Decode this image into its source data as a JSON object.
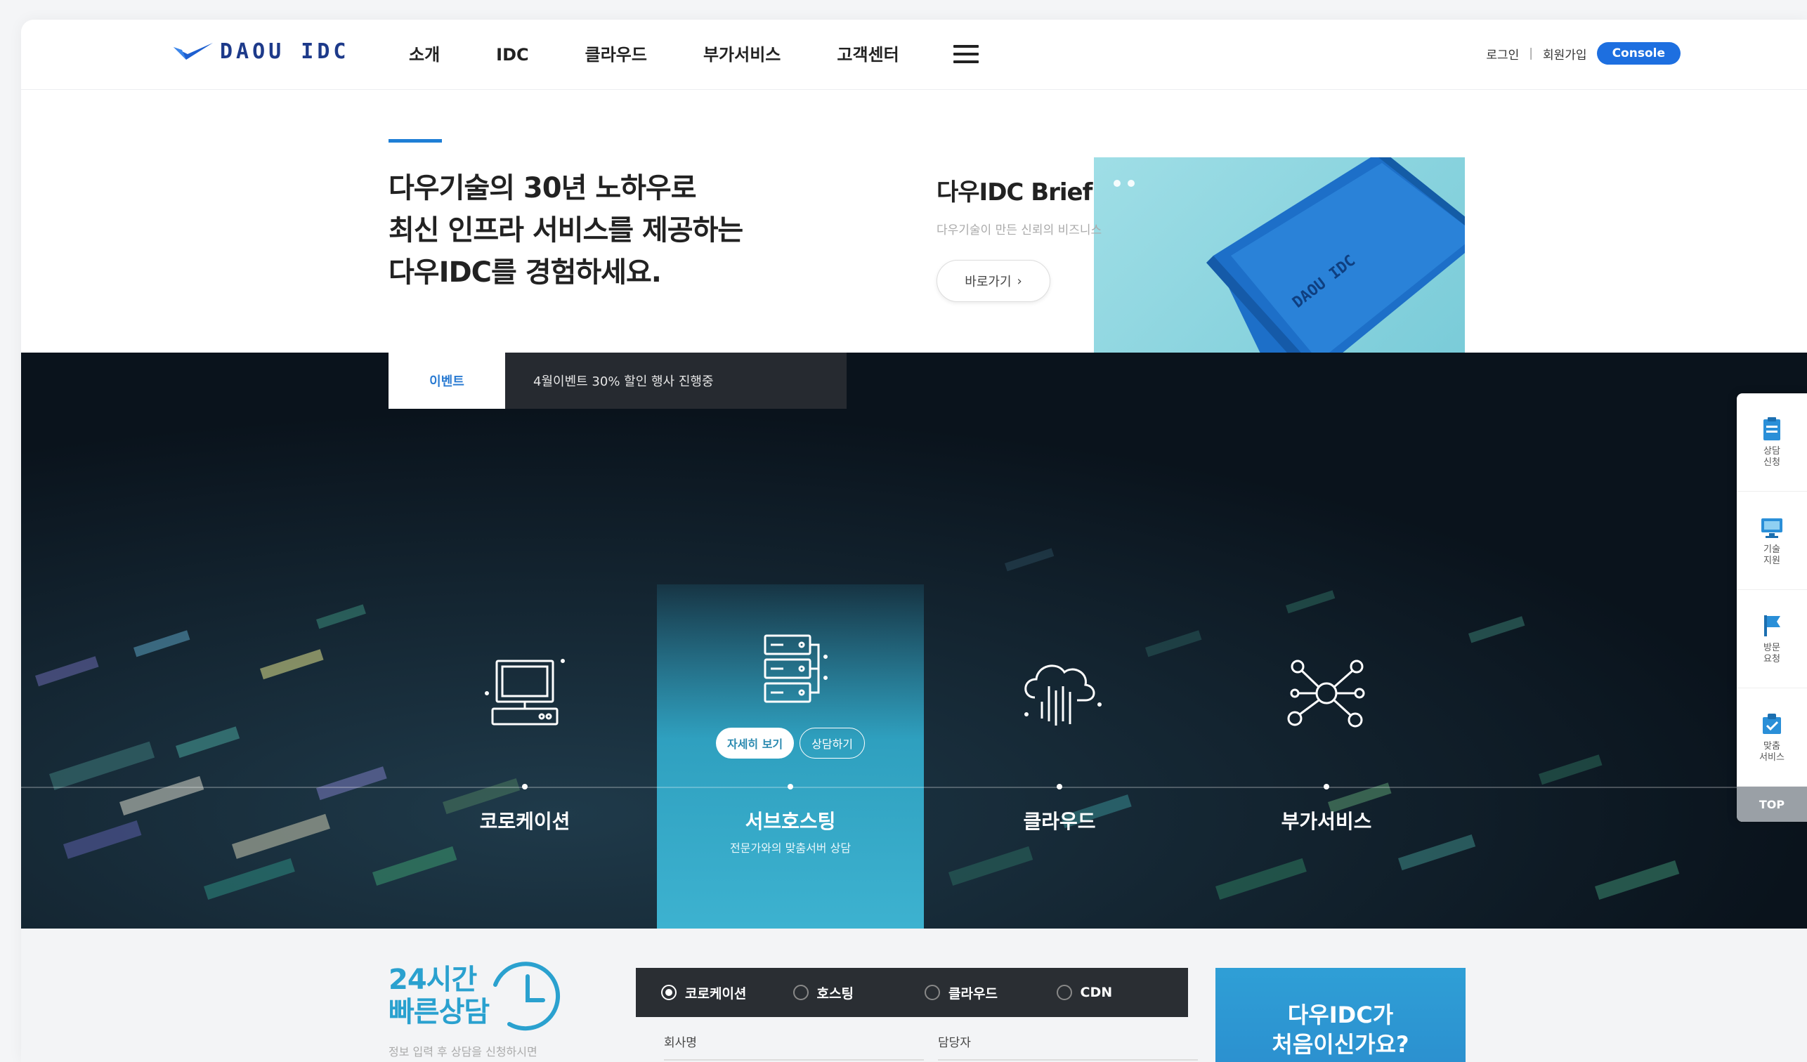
{
  "header": {
    "logo_text": "DAOU IDC",
    "nav": [
      "소개",
      "IDC",
      "클라우드",
      "부가서비스",
      "고객센터"
    ],
    "login": "로그인",
    "separator": "|",
    "signup": "회원가입",
    "console": "Console"
  },
  "intro": {
    "headline_lines": [
      "다우기술의 30년 노하우로",
      "최신 인프라 서비스를 제공하는",
      "다우IDC를 경험하세요."
    ],
    "brief_title": "다우IDC Brief",
    "brief_sub": "다우기술이 만든 신뢰의 비즈니스",
    "brief_button": "바로가기",
    "brief_image_text": "DAOU IDC"
  },
  "event": {
    "tag": "이벤트",
    "text": "4월이벤트 30% 할인 행사 진행중"
  },
  "services": [
    {
      "label": "코로케이션",
      "icon": "server-monitor-icon"
    },
    {
      "label": "서브호스팅",
      "icon": "server-rack-icon",
      "sub": "전문가와의 맞춤서버 상담",
      "pill_detail": "자세히 보기",
      "pill_consult": "상담하기"
    },
    {
      "label": "클라우드",
      "icon": "cloud-server-icon"
    },
    {
      "label": "부가서비스",
      "icon": "network-hub-icon"
    }
  ],
  "quickbar": {
    "items": [
      {
        "label": "상담 신청",
        "icon": "clipboard-icon"
      },
      {
        "label": "기술 지원",
        "icon": "monitor-support-icon"
      },
      {
        "label": "방문 요청",
        "icon": "visit-flag-icon"
      },
      {
        "label": "맞춤 서비스",
        "icon": "custom-service-icon"
      }
    ],
    "top": "TOP"
  },
  "consult": {
    "title_line1": "24시간",
    "title_line2": "빠른상담",
    "note": "정보 입력 후 상담을 신청하시면",
    "options": [
      "코로케이션",
      "호스팅",
      "클라우드",
      "CDN"
    ],
    "selected": "코로케이션",
    "field_company": "회사명",
    "field_manager": "담당자",
    "first_box_line1": "다우IDC가",
    "first_box_line2": "처음이신가요?"
  },
  "colors": {
    "accent": "#1d6fe0",
    "brand_navy": "#1d3a8a",
    "teal": "#3db2d0"
  }
}
